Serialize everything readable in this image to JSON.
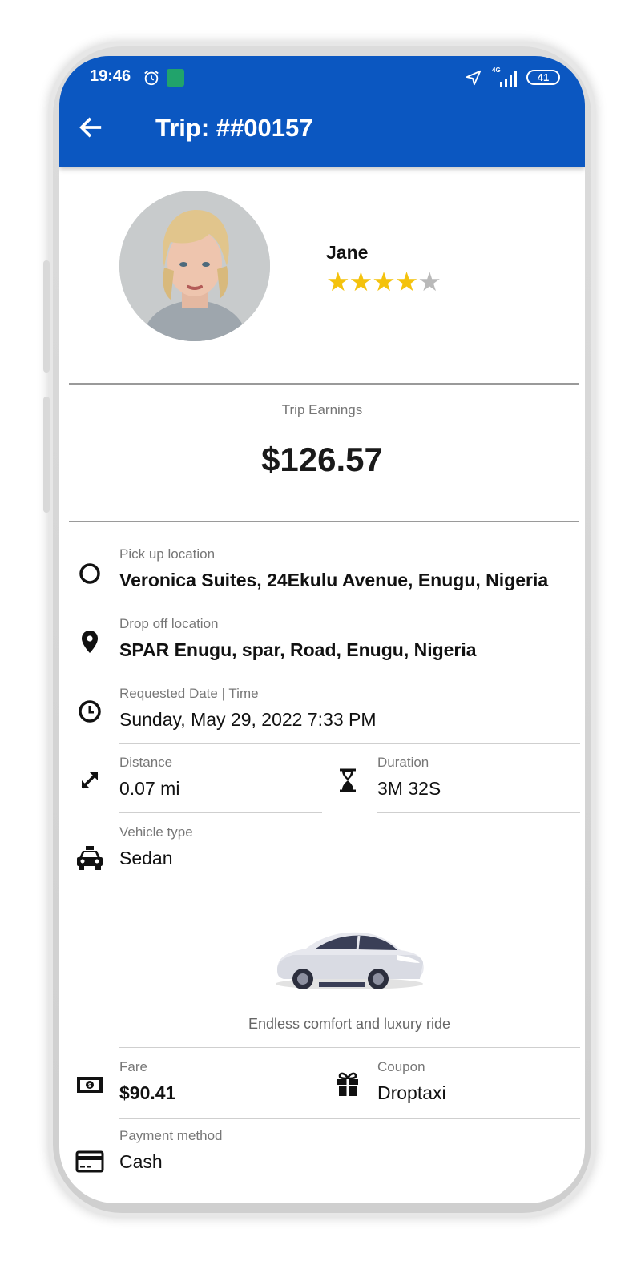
{
  "status_bar": {
    "time": "19:46",
    "network": "4G",
    "battery": "41"
  },
  "header": {
    "title": "Trip: ##00157"
  },
  "driver": {
    "name": "Jane",
    "rating": 4,
    "rating_max": 5
  },
  "earnings": {
    "label": "Trip Earnings",
    "value": "$126.57"
  },
  "pickup": {
    "label": "Pick up location",
    "value": "Veronica Suites, 24Ekulu Avenue, Enugu, Nigeria"
  },
  "dropoff": {
    "label": "Drop off location",
    "value": "SPAR Enugu, spar, Road, Enugu, Nigeria"
  },
  "requested": {
    "label": "Requested Date | Time",
    "value": "Sunday, May 29, 2022 7:33 PM"
  },
  "distance": {
    "label": "Distance",
    "value": "0.07 mi"
  },
  "duration": {
    "label": "Duration",
    "value": "3M 32S"
  },
  "vehicle": {
    "label": "Vehicle type",
    "value": "Sedan",
    "tagline": "Endless comfort and luxury ride"
  },
  "fare": {
    "label": "Fare",
    "value": "$90.41"
  },
  "coupon": {
    "label": "Coupon",
    "value": "Droptaxi"
  },
  "payment": {
    "label": "Payment method",
    "value": "Cash"
  },
  "colors": {
    "appbar": "#0b57c1",
    "star": "#f4c20d",
    "star_empty": "#b9b9b9"
  },
  "icons": [
    "back-arrow-icon",
    "pickup-circle-icon",
    "location-pin-icon",
    "clock-icon",
    "expand-arrows-icon",
    "hourglass-icon",
    "taxi-icon",
    "cash-icon",
    "gift-icon",
    "credit-card-icon"
  ]
}
